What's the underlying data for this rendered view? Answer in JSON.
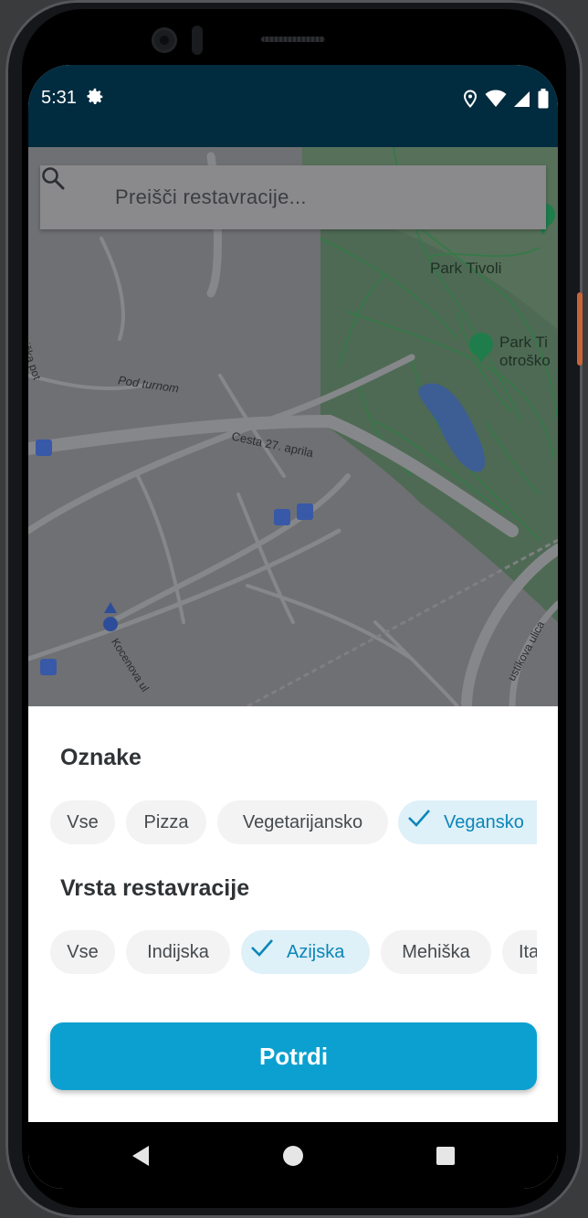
{
  "status_bar": {
    "time": "5:31",
    "icons": [
      "gear-icon",
      "location-icon",
      "wifi-icon",
      "signal-icon",
      "battery-icon"
    ]
  },
  "map": {
    "search": {
      "placeholder": "Preišči restavracije...",
      "icon": "search-icon"
    },
    "labels": {
      "park_tivoli": "Park Tivoli",
      "park_ti_line1": "Park Ti",
      "park_ti_line2": "otroško",
      "podroznik": "Podrožniška pot",
      "pod_turnom": "Pod turnom",
      "cesta": "Cesta 27. aprila",
      "kocenova": "Kocenova ul",
      "ustikova": "ustikova ulica"
    }
  },
  "filters": {
    "tags": {
      "title": "Oznake",
      "chips": [
        {
          "label": "Vse",
          "selected": false
        },
        {
          "label": "Pizza",
          "selected": false
        },
        {
          "label": "Vegetarijansko",
          "selected": false
        },
        {
          "label": "Vegansko",
          "selected": true
        }
      ]
    },
    "restaurant_type": {
      "title": "Vrsta restavracije",
      "chips": [
        {
          "label": "Vse",
          "selected": false
        },
        {
          "label": "Indijska",
          "selected": false
        },
        {
          "label": "Azijska",
          "selected": true
        },
        {
          "label": "Mehiška",
          "selected": false
        },
        {
          "label": "Italijanska",
          "selected": false
        }
      ]
    },
    "confirm_label": "Potrdi"
  },
  "colors": {
    "status_bar": "#012b3f",
    "accent": "#0ca0d0",
    "chip_selected_bg": "#def0f8",
    "chip_selected_text": "#0b86b8"
  },
  "nav_bar": {
    "icons": [
      "back-icon",
      "home-icon",
      "recents-icon"
    ]
  }
}
